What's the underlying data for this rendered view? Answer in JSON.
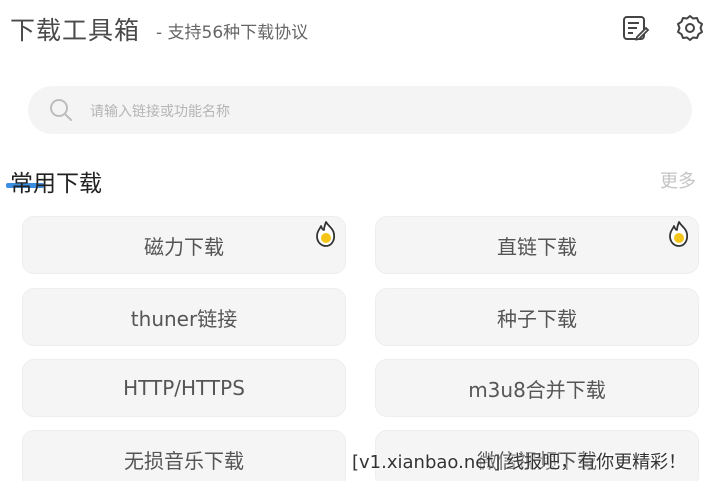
{
  "header": {
    "title": "下载工具箱",
    "subtitle": "- 支持56种下载协议",
    "notes_icon": "edit-list-icon",
    "settings_icon": "gear-icon"
  },
  "search": {
    "placeholder": "请输入链接或功能名称",
    "icon": "search-icon"
  },
  "section": {
    "title": "常用下载",
    "more_label": "更多",
    "accent_color": "#3b8ddf"
  },
  "tiles": [
    {
      "label": "磁力下载",
      "hot": true
    },
    {
      "label": "直链下载",
      "hot": true
    },
    {
      "label": "thuner链接",
      "hot": false
    },
    {
      "label": "种子下载",
      "hot": false
    },
    {
      "label": "HTTP/HTTPS",
      "hot": false
    },
    {
      "label": "m3u8合并下载",
      "hot": false
    },
    {
      "label": "无损音乐下载",
      "hot": false
    },
    {
      "label": "微信视频下载",
      "hot": false
    }
  ],
  "hot_badge": {
    "icon": "fire-badge-icon",
    "color": "#f5c518"
  },
  "watermark": "[v1.xianbao.net] 线报吧，有你更精彩！"
}
